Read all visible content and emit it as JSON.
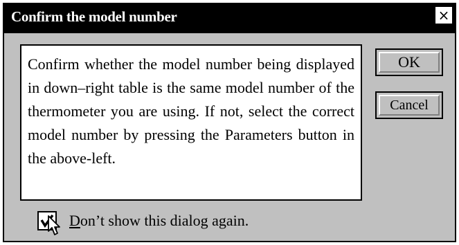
{
  "dialog": {
    "title": "Confirm the model number",
    "close_glyph": "×",
    "message": "Confirm whether the model number being displayed in down–right table is the same model number of the thermometer you are using. If not, select the correct model number by pressing the Parameters button in the above-left.",
    "buttons": {
      "ok_label": "OK",
      "cancel_label": "Cancel"
    },
    "checkbox": {
      "checked": true,
      "label_mnemonic": "D",
      "label_rest": "on’t show this dialog again."
    },
    "icons": {
      "close": "close-icon",
      "check": "check-icon",
      "cursor": "arrow-cursor-icon"
    },
    "colors": {
      "face": "#c0c0c0",
      "title_bar": "#000000",
      "title_text": "#ffffff"
    }
  }
}
